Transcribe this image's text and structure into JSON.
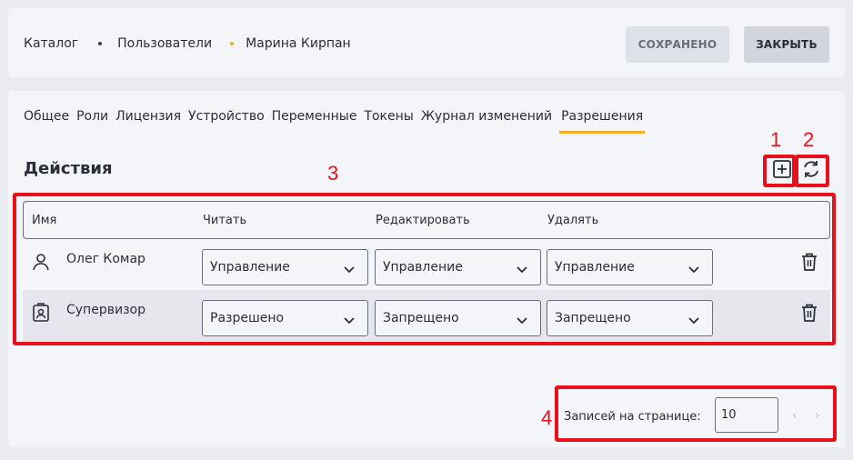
{
  "breadcrumbs": [
    "Каталог",
    "Пользователи",
    "Марина Кирпан"
  ],
  "buttons": {
    "saved": "СОХРАНЕНО",
    "close": "ЗАКРЫТЬ"
  },
  "tabs": [
    "Общее",
    "Роли",
    "Лицензия",
    "Устройство",
    "Переменные",
    "Токены",
    "Журнал изменений",
    "Разрешения"
  ],
  "active_tab": "Разрешения",
  "section": {
    "title": "Действия"
  },
  "annotations": [
    "1",
    "2",
    "3",
    "4"
  ],
  "table": {
    "headers": [
      "Имя",
      "Читать",
      "Редактировать",
      "Удалять"
    ],
    "rows": [
      {
        "icon": "user-icon",
        "name": "Олег Комар",
        "read": "Управление",
        "edit": "Управление",
        "delete": "Управление"
      },
      {
        "icon": "badge-icon",
        "name": "Супервизор",
        "read": "Разрешено",
        "edit": "Запрещено",
        "delete": "Запрещено"
      }
    ]
  },
  "pager": {
    "label": "Записей на странице:",
    "value": "10"
  },
  "colors": {
    "accent": "#f4ac20",
    "annotation": "#e8101a"
  }
}
